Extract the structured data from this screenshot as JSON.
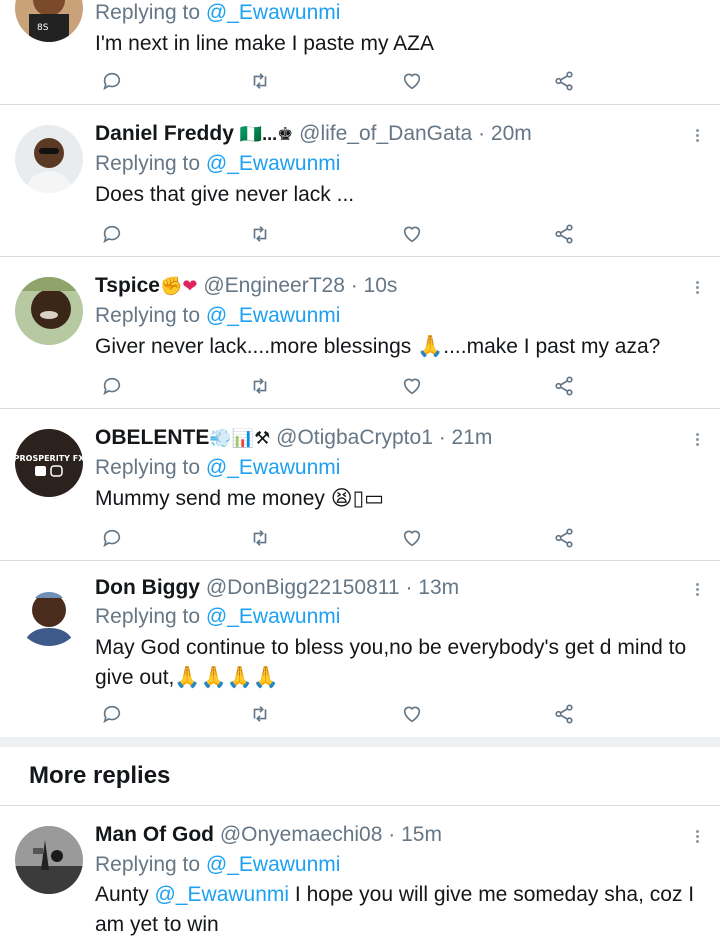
{
  "reply_prefix": "Replying to",
  "reply_to": "@_Ewawunmi",
  "section": {
    "more_replies": "More replies"
  },
  "colors": {
    "link": "#1da1f2",
    "muted": "#657786",
    "divider": "#d9dde1"
  },
  "icons": [
    "reply-icon",
    "retweet-icon",
    "like-icon",
    "share-icon",
    "more-icon"
  ],
  "tweets": [
    {
      "name": "",
      "name_suffix": "",
      "handle": "",
      "time": "",
      "text": "I'm next in line make I paste my AZA",
      "text2": ""
    },
    {
      "name": "Daniel Freddy",
      "name_suffix": "🇳🇬...♚",
      "handle": "@life_of_DanGata",
      "time": "· 20m",
      "text": "Does that give never lack ...",
      "text2": ""
    },
    {
      "name": "Tspice",
      "name_suffix": "✊❤",
      "handle": "@EngineerT28",
      "time": "· 10s",
      "text": "Giver never lack....more blessings 🙏....make I past my aza?",
      "text2": ""
    },
    {
      "name": "OBELENTE",
      "name_suffix": "💨📊⚒",
      "handle": "@OtigbaCrypto1",
      "time": "· 21m",
      "text": "Mummy send me money 😫▯▭",
      "text2": ""
    },
    {
      "name": "Don Biggy",
      "name_suffix": "",
      "handle": "@DonBigg22150811",
      "time": "· 13m",
      "text": "May God continue to bless you,no be everybody's get d mind to",
      "text2": "give out,🙏🙏🙏🙏"
    },
    {
      "name": "Man Of God",
      "name_suffix": "",
      "handle": "@Onyemaechi08",
      "time": "· 15m",
      "text_pre": "Aunty",
      "text_mention": "@_Ewawunmi",
      "text": "I hope you will give me someday sha, coz I",
      "text2": "am yet to win"
    }
  ]
}
